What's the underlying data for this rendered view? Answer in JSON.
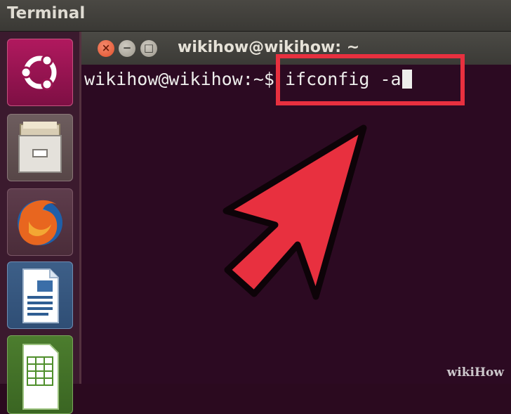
{
  "top_panel": {
    "title": "Terminal"
  },
  "launcher": {
    "items": [
      {
        "name": "ubuntu-dash",
        "icon": "ubuntu-logo-icon"
      },
      {
        "name": "files",
        "icon": "file-cabinet-icon"
      },
      {
        "name": "firefox",
        "icon": "firefox-icon"
      },
      {
        "name": "libreoffice-writer",
        "icon": "document-icon"
      },
      {
        "name": "libreoffice-calc",
        "icon": "spreadsheet-icon"
      }
    ]
  },
  "terminal": {
    "window_title": "wikihow@wikihow: ~",
    "buttons": {
      "close": "×",
      "minimize": "−",
      "maximize": "□"
    },
    "prompt": "wikihow@wikihow:~$ ",
    "command": "ifconfig -a"
  },
  "annotation": {
    "highlight_color": "#e8303f",
    "arrow_color": "#e8303f"
  },
  "watermark": {
    "text": "wikiHow"
  }
}
